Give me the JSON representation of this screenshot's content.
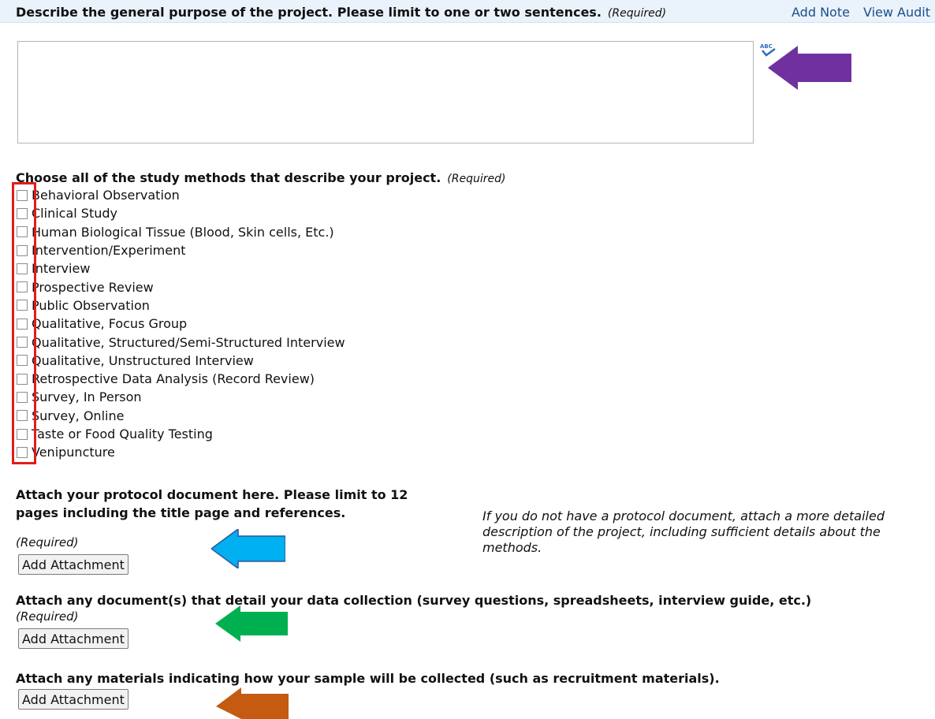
{
  "purpose_question": {
    "label": "Describe the general purpose of the project. Please limit to one or two sentences.",
    "required": "(Required)",
    "add_note": "Add Note",
    "view_audit": "View Audit",
    "textarea_value": ""
  },
  "spellcheck_icon": "spellcheck-icon",
  "methods_question": {
    "label": "Choose all of the study methods that describe your project.",
    "required": "(Required)",
    "options": [
      "Behavioral Observation",
      "Clinical Study",
      "Human Biological Tissue (Blood, Skin cells, Etc.)",
      "Intervention/Experiment",
      "Interview",
      "Prospective Review",
      "Public Observation",
      "Qualitative, Focus Group",
      "Qualitative, Structured/Semi-Structured Interview",
      "Qualitative, Unstructured Interview",
      "Retrospective Data Analysis (Record Review)",
      "Survey, In Person",
      "Survey, Online",
      "Taste or Food Quality Testing",
      "Venipuncture"
    ]
  },
  "protocol_attachment": {
    "label_line1": "Attach your protocol document here. Please limit to 12",
    "label_line2": "pages including the title page and references.",
    "note": "If you do not have a protocol document, attach a more detailed description of the project, including sufficient details about the methods.",
    "required": "(Required)",
    "button": "Add Attachment"
  },
  "data_collection_attachment": {
    "label": "Attach any document(s) that detail your data collection (survey questions, spreadsheets, interview guide, etc.)",
    "required": "(Required)",
    "button": "Add Attachment"
  },
  "sample_materials_attachment": {
    "label": "Attach any materials indicating how your sample will be collected (such as recruitment materials).",
    "button": "Add Attachment"
  },
  "annotation_colors": {
    "purple_arrow": "#7030a0",
    "blue_arrow": "#00b0f0",
    "green_arrow": "#00b050",
    "orange_arrow": "#c55a11",
    "red_box": "#e41b1b"
  }
}
